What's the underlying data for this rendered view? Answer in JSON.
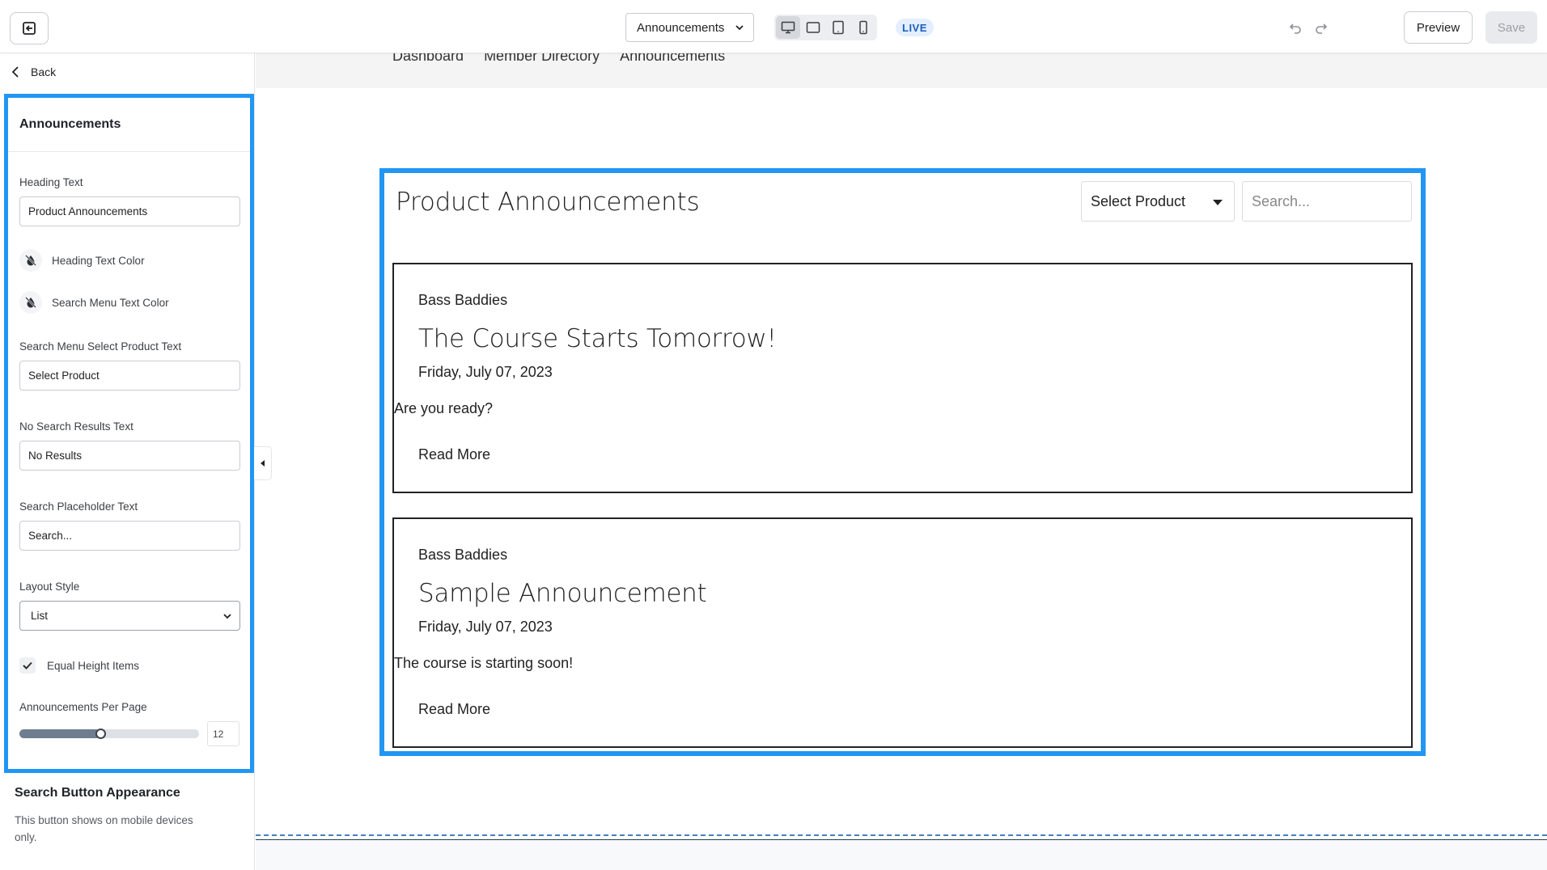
{
  "topbar": {
    "page_select_value": "Announcements",
    "live_badge": "LIVE",
    "preview_label": "Preview",
    "save_label": "Save",
    "devices": [
      "desktop-icon",
      "tablet-landscape-icon",
      "tablet-portrait-icon",
      "mobile-icon"
    ]
  },
  "sidebar": {
    "back_label": "Back",
    "panel_title": "Announcements",
    "heading_text_label": "Heading Text",
    "heading_text_value": "Product Announcements",
    "heading_color_label": "Heading Text Color",
    "search_menu_color_label": "Search Menu Text Color",
    "select_product_label": "Search Menu Select Product Text",
    "select_product_value": "Select Product",
    "no_results_label": "No Search Results Text",
    "no_results_value": "No Results",
    "search_placeholder_label": "Search Placeholder Text",
    "search_placeholder_value": "Search...",
    "layout_style_label": "Layout Style",
    "layout_style_value": "List",
    "equal_height_label": "Equal Height Items",
    "equal_height_checked": true,
    "per_page_label": "Announcements Per Page",
    "per_page_value": "12",
    "per_page_slider_fraction": 0.45,
    "search_button_title": "Search Button Appearance",
    "search_button_desc": "This button shows on mobile devices only."
  },
  "canvas": {
    "nav_links": [
      "Dashboard",
      "Member Directory",
      "Announcements"
    ],
    "heading": "Product Announcements",
    "product_select": "Select Product",
    "search_placeholder": "Search...",
    "announcements": [
      {
        "category": "Bass Baddies",
        "title": "The Course Starts Tomorrow!",
        "date": "Friday, July 07, 2023",
        "excerpt": "Are you ready?",
        "link": "Read More"
      },
      {
        "category": "Bass Baddies",
        "title": "Sample Announcement",
        "date": "Friday, July 07, 2023",
        "excerpt": "The course is starting soon!",
        "link": "Read More"
      }
    ]
  },
  "colors": {
    "selection_outline": "#2196f3",
    "live_badge_bg": "#e3efff",
    "live_badge_text": "#1b5fb8"
  }
}
